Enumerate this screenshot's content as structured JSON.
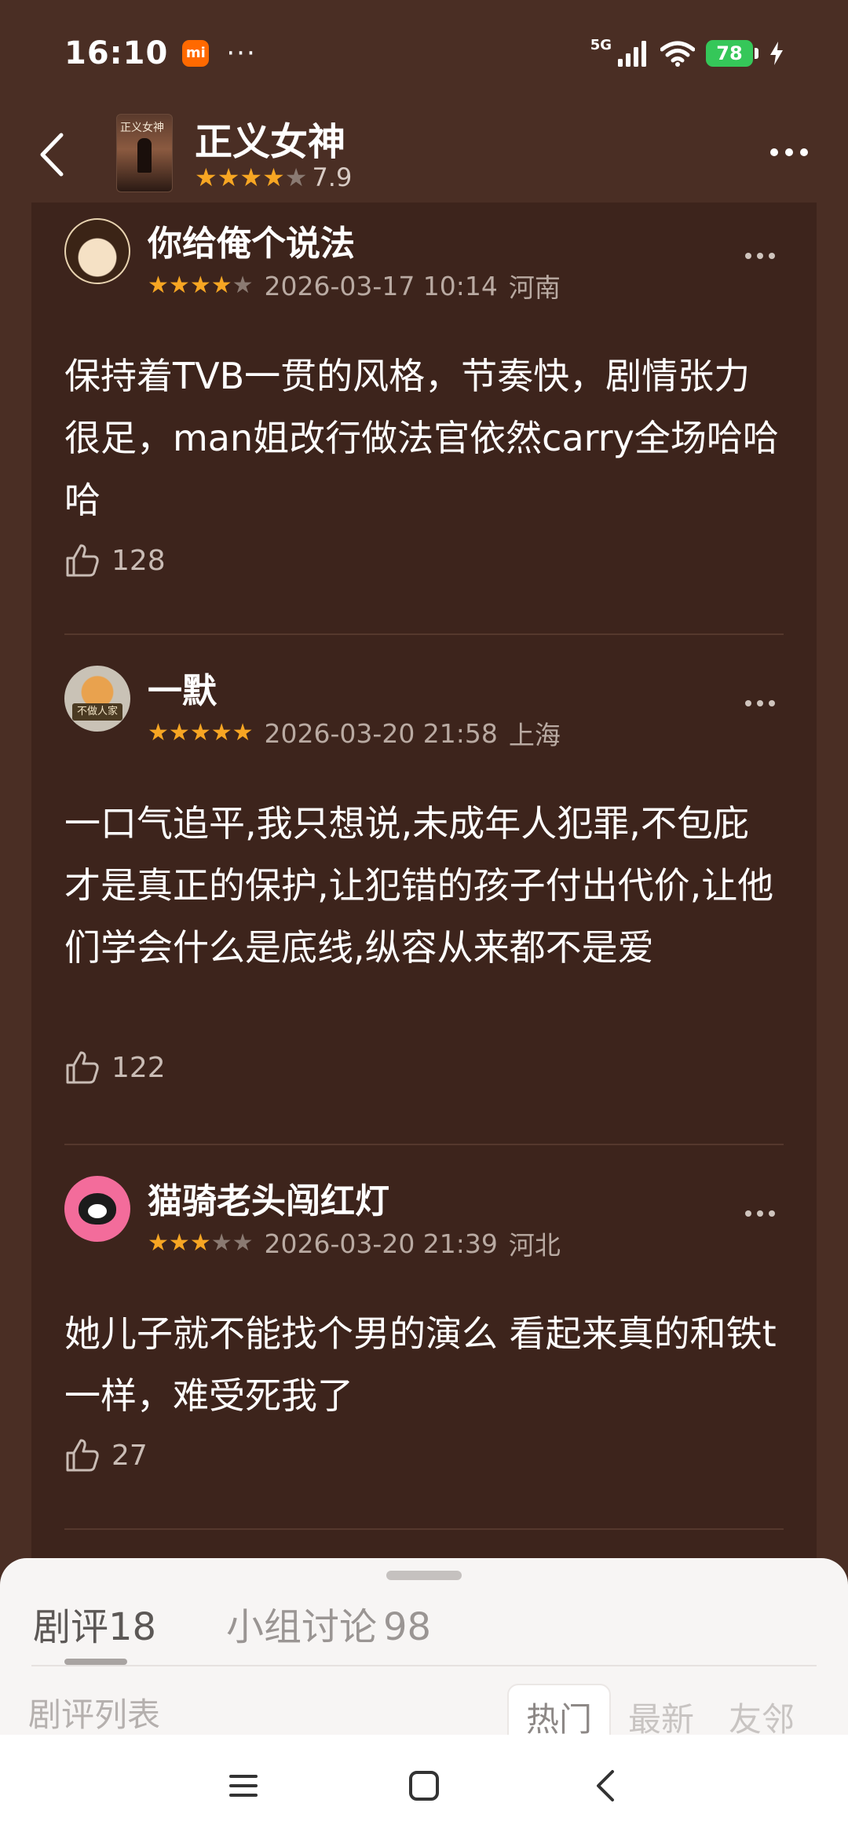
{
  "status_bar": {
    "time": "16:10",
    "mi_badge": "mi",
    "dots": "···",
    "network": "5G",
    "battery": "78"
  },
  "header": {
    "title": "正义女神",
    "poster_text": "正义女神",
    "rating_stars": 4,
    "score": "7.9"
  },
  "reviews": [
    {
      "user": "你给俺个说法",
      "stars": 4,
      "time": "2026-03-17 10:14",
      "region": "河南",
      "text": "保持着TVB一贯的风格，节奏快，剧情张力很足，man姐改行做法官依然carry全场哈哈哈",
      "likes": "128"
    },
    {
      "user": "一默",
      "stars": 5,
      "time": "2026-03-20 21:58",
      "region": "上海",
      "avatar_text": "不做人家",
      "text": "一口气追平,我只想说,未成年人犯罪,不包庇才是真正的保护,让犯错的孩子付出代价,让他们学会什么是底线,纵容从来都不是爱",
      "likes": "122"
    },
    {
      "user": "猫骑老头闯红灯",
      "stars": 3,
      "time": "2026-03-20 21:39",
      "region": "河北",
      "text": "她儿子就不能找个男的演么 看起来真的和铁t一样，难受死我了",
      "likes": "27"
    }
  ],
  "sheet": {
    "tabs": [
      {
        "label": "剧评",
        "count": "18"
      },
      {
        "label": "小组讨论",
        "count": "98"
      }
    ],
    "list_label": "剧评列表",
    "sort_options": [
      "热门",
      "最新",
      "友邻"
    ]
  },
  "colors": {
    "background": "#4a2e24",
    "panel": "#3d241c",
    "star_on": "#f7a623",
    "battery": "#35c759"
  }
}
